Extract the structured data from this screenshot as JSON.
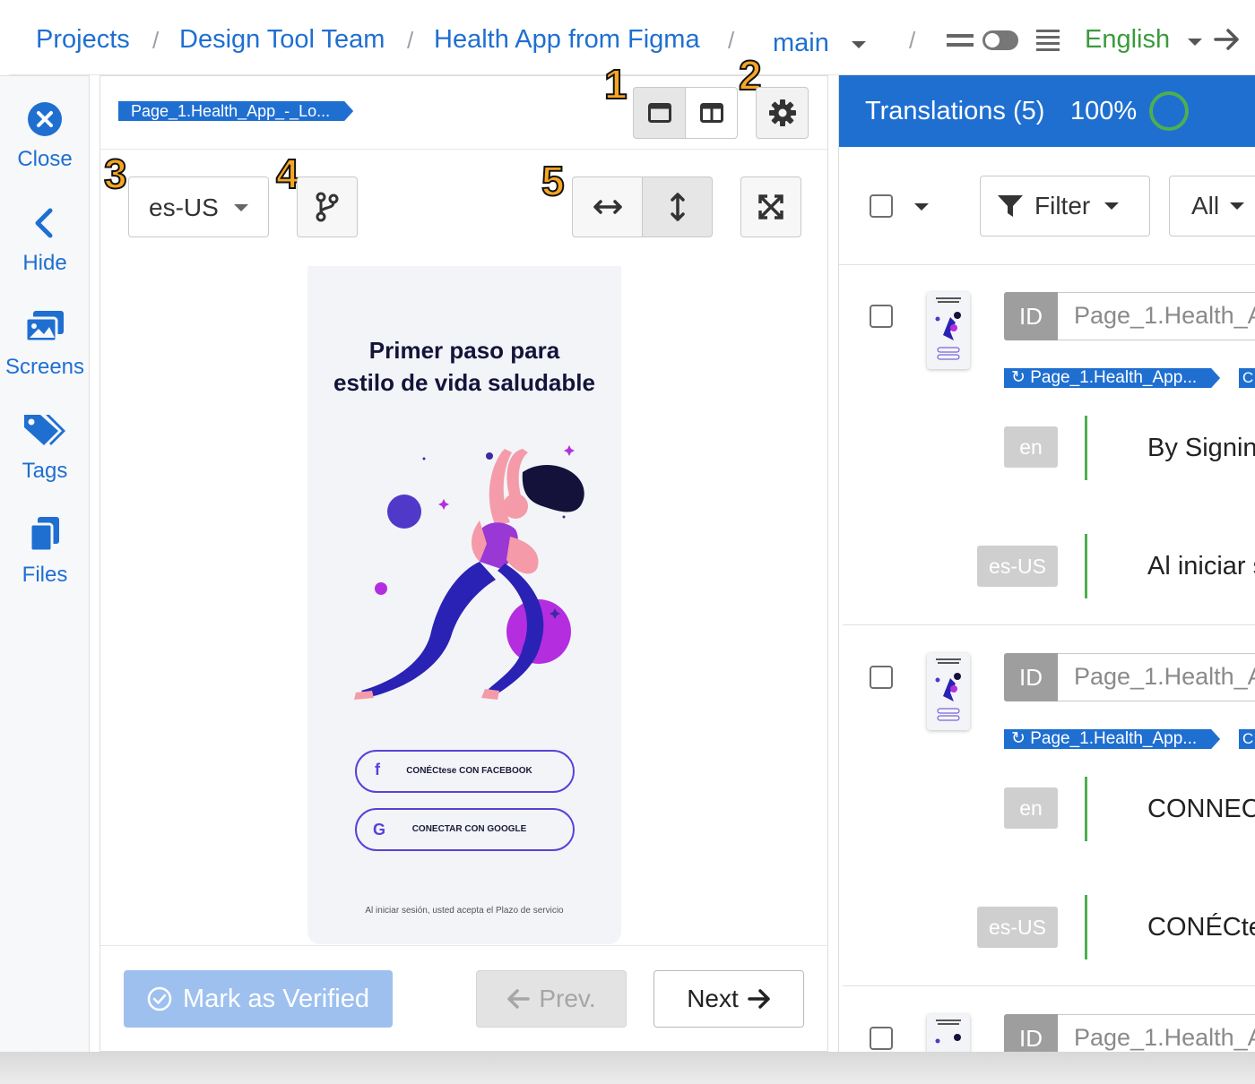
{
  "breadcrumb": {
    "projects": "Projects",
    "team": "Design Tool Team",
    "project": "Health App from Figma",
    "branch": "main",
    "language": "English",
    "separator": "/"
  },
  "sidebar": {
    "items": [
      {
        "label": "Close",
        "icon": "close-circle-icon"
      },
      {
        "label": "Hide",
        "icon": "chevron-left-icon"
      },
      {
        "label": "Screens",
        "icon": "images-icon"
      },
      {
        "label": "Tags",
        "icon": "tags-icon"
      },
      {
        "label": "Files",
        "icon": "files-icon"
      }
    ]
  },
  "center": {
    "screen_tag": "Page_1.Health_App_-_Lo...",
    "locale_value": "es-US",
    "badges": [
      "1",
      "2",
      "3",
      "4",
      "5"
    ],
    "preview": {
      "title_line1": "Primer paso para",
      "title_line2": "estilo de vida saludable",
      "facebook_button": "CONÉCtese CON FACEBOOK",
      "google_button": "CONECTAR CON GOOGLE",
      "footer": "Al iniciar sesión, usted acepta el Plazo de servicio"
    },
    "mark_verified": "Mark as Verified",
    "prev": "Prev.",
    "next": "Next"
  },
  "translations": {
    "title": "Translations (5)",
    "progress": "100%",
    "progress_value": 1.0,
    "filter_label": "Filter",
    "all_label": "All",
    "id_label": "ID",
    "items": [
      {
        "id_value": "Page_1.Health_A",
        "screen_chip": "Page_1.Health_App...",
        "chip_more": "C",
        "source_lang": "en",
        "source_text": "By Signin",
        "target_lang": "es-US",
        "target_text": "Al iniciar s"
      },
      {
        "id_value": "Page_1.Health_A",
        "screen_chip": "Page_1.Health_App...",
        "chip_more": "C",
        "source_lang": "en",
        "source_text": "CONNECT",
        "target_lang": "es-US",
        "target_text": "CONÉCtes"
      },
      {
        "id_value": "Page_1.Health_A"
      }
    ]
  },
  "colors": {
    "brand_blue": "#1f6fd1",
    "badge_orange": "#f6a623",
    "progress_green": "#4caf50",
    "language_green": "#3c9a3c"
  }
}
